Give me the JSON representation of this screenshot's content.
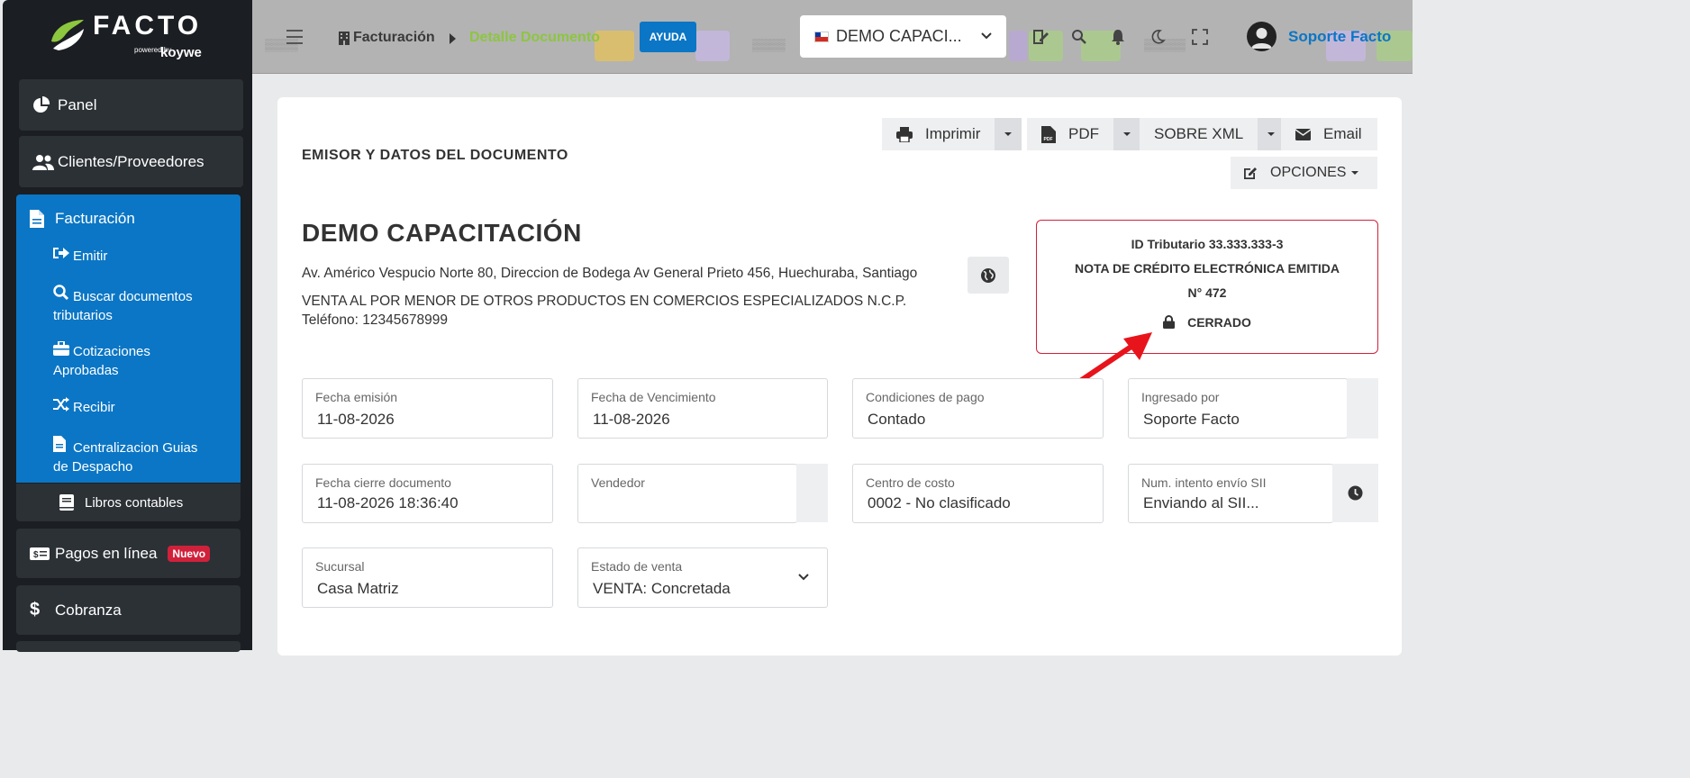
{
  "sidebar": {
    "logo_text": "FACTO",
    "logo_powered": "powered by",
    "logo_brand": "koywe",
    "items": [
      {
        "label": "Panel",
        "icon": "pie-chart-icon"
      },
      {
        "label": "Clientes/Proveedores",
        "icon": "users-icon"
      },
      {
        "label": "Facturación",
        "icon": "file-icon"
      },
      {
        "label": "Libros contables",
        "icon": "book-icon"
      },
      {
        "label": "Pagos en línea",
        "icon": "money-icon",
        "badge": "Nuevo"
      },
      {
        "label": "Cobranza",
        "icon": "dollar-icon"
      }
    ],
    "sub_items": [
      {
        "label": "Emitir",
        "icon": "sign-out-icon"
      },
      {
        "label_l1": "Buscar documentos",
        "label_l2": "tributarios",
        "icon": "search-icon"
      },
      {
        "label_l1": "Cotizaciones",
        "label_l2": "Aprobadas",
        "icon": "briefcase-icon"
      },
      {
        "label": "Recibir",
        "icon": "shuffle-icon"
      },
      {
        "label_l1": "Centralizacion Guias",
        "label_l2": "de Despacho",
        "icon": "file-icon"
      }
    ]
  },
  "header": {
    "breadcrumb_root": "Facturación",
    "breadcrumb_current": "Detalle Documento",
    "help_label": "AYUDA",
    "company_selector": "DEMO CAPACI...",
    "user_name": "Soporte Facto"
  },
  "toolbar": {
    "print_label": "Imprimir",
    "pdf_label": "PDF",
    "xml_label": "SOBRE XML",
    "email_label": "Email",
    "options_label": "OPCIONES"
  },
  "document": {
    "section_title": "EMISOR Y DATOS DEL DOCUMENTO",
    "company_name": "DEMO CAPACITACIÓN",
    "address": "Av. Américo Vespucio Norte 80, Direccion de Bodega Av General Prieto 456, Huechuraba, Santiago",
    "activity": "VENTA AL POR MENOR DE OTROS PRODUCTOS EN COMERCIOS ESPECIALIZADOS N.C.P.",
    "phone": "Teléfono: 12345678999",
    "tax_id": "ID Tributario 33.333.333-3",
    "doc_type": "NOTA DE CRÉDITO ELECTRÓNICA EMITIDA",
    "doc_number": "N° 472",
    "status": "CERRADO"
  },
  "fields": {
    "fecha_emision": {
      "label": "Fecha emisión",
      "value": "11-08-2026"
    },
    "fecha_vencimiento": {
      "label": "Fecha de Vencimiento",
      "value": "11-08-2026"
    },
    "condiciones_pago": {
      "label": "Condiciones de pago",
      "value": "Contado"
    },
    "ingresado_por": {
      "label": "Ingresado por",
      "value": "Soporte Facto"
    },
    "fecha_cierre": {
      "label": "Fecha cierre documento",
      "value": "11-08-2026 18:36:40"
    },
    "vendedor": {
      "label": "Vendedor",
      "value": ""
    },
    "centro_costo": {
      "label": "Centro de costo",
      "value": "0002 - No clasificado"
    },
    "intento_envio": {
      "label": "Num. intento envío SII",
      "value": "Enviando al SII..."
    },
    "sucursal": {
      "label": "Sucursal",
      "value": "Casa Matriz"
    },
    "estado_venta": {
      "label": "Estado de venta",
      "value": "VENTA: Concretada"
    }
  },
  "colors": {
    "sidebar_bg": "#1b1e22",
    "nav_item_bg": "#2c3136",
    "active_blue": "#0b76c5",
    "breadcrumb_green": "#8dc63f",
    "badge_red": "#d0213b",
    "doc_box_border": "#d0213b",
    "arrow_red": "#e8141c"
  }
}
